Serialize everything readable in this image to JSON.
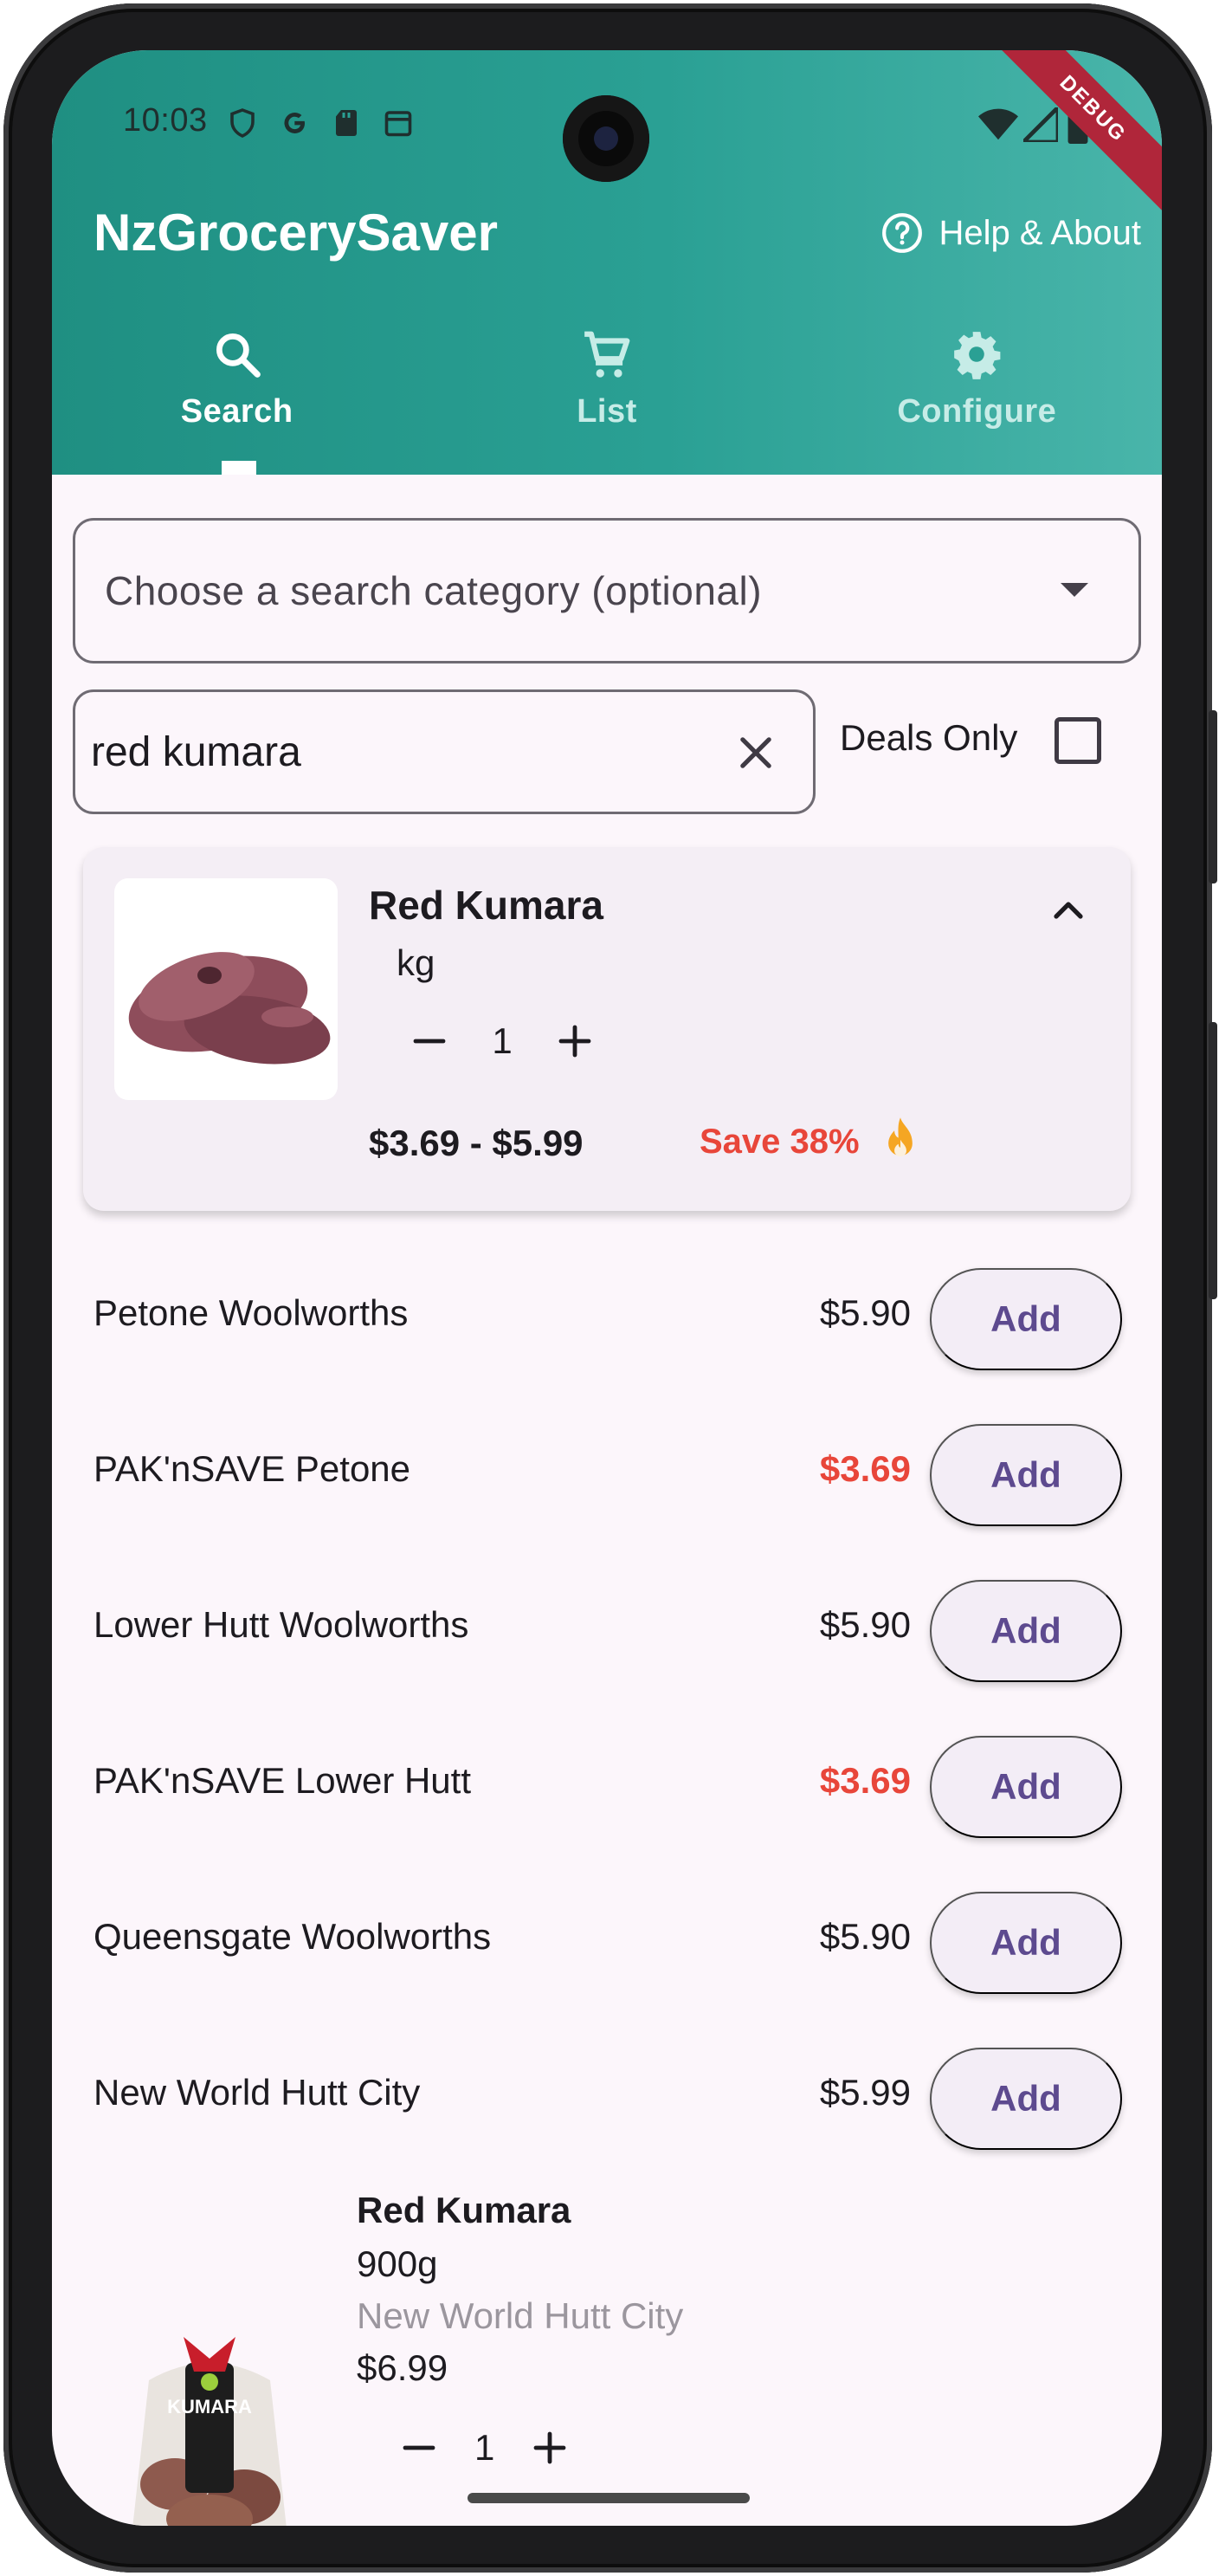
{
  "status_bar": {
    "time": "10:03"
  },
  "debug_banner": "DEBUG",
  "app_bar": {
    "title": "NzGrocerySaver",
    "help_label": "Help & About"
  },
  "tabs": [
    {
      "label": "Search",
      "icon": "search-icon",
      "active": true
    },
    {
      "label": "List",
      "icon": "cart-icon",
      "active": false
    },
    {
      "label": "Configure",
      "icon": "gear-icon",
      "active": false
    }
  ],
  "filters": {
    "category_placeholder": "Choose a search category (optional)",
    "search_value": "red kumara",
    "deals_only_label": "Deals Only",
    "deals_only_checked": false
  },
  "product_card": {
    "name": "Red Kumara",
    "unit": "kg",
    "quantity": "1",
    "price_range": "$3.69 - $5.99",
    "save_text": "Save 38%",
    "expanded": true
  },
  "store_prices": [
    {
      "store": "Petone Woolworths",
      "price": "$5.90",
      "deal": false,
      "button": "Add"
    },
    {
      "store": "PAK'nSAVE Petone",
      "price": "$3.69",
      "deal": true,
      "button": "Add"
    },
    {
      "store": "Lower Hutt Woolworths",
      "price": "$5.90",
      "deal": false,
      "button": "Add"
    },
    {
      "store": "PAK'nSAVE Lower Hutt",
      "price": "$3.69",
      "deal": true,
      "button": "Add"
    },
    {
      "store": "Queensgate Woolworths",
      "price": "$5.90",
      "deal": false,
      "button": "Add"
    },
    {
      "store": "New World Hutt City",
      "price": "$5.99",
      "deal": false,
      "button": "Add"
    }
  ],
  "second_result": {
    "name": "Red Kumara",
    "unit": "900g",
    "store": "New World Hutt City",
    "price": "$6.99",
    "quantity": "1",
    "bag_label": "KUMARA"
  },
  "colors": {
    "app_bar": "#2aa094",
    "deal_red": "#e8463a",
    "button_text": "#5d4a8f",
    "background": "#fcf6fb"
  }
}
